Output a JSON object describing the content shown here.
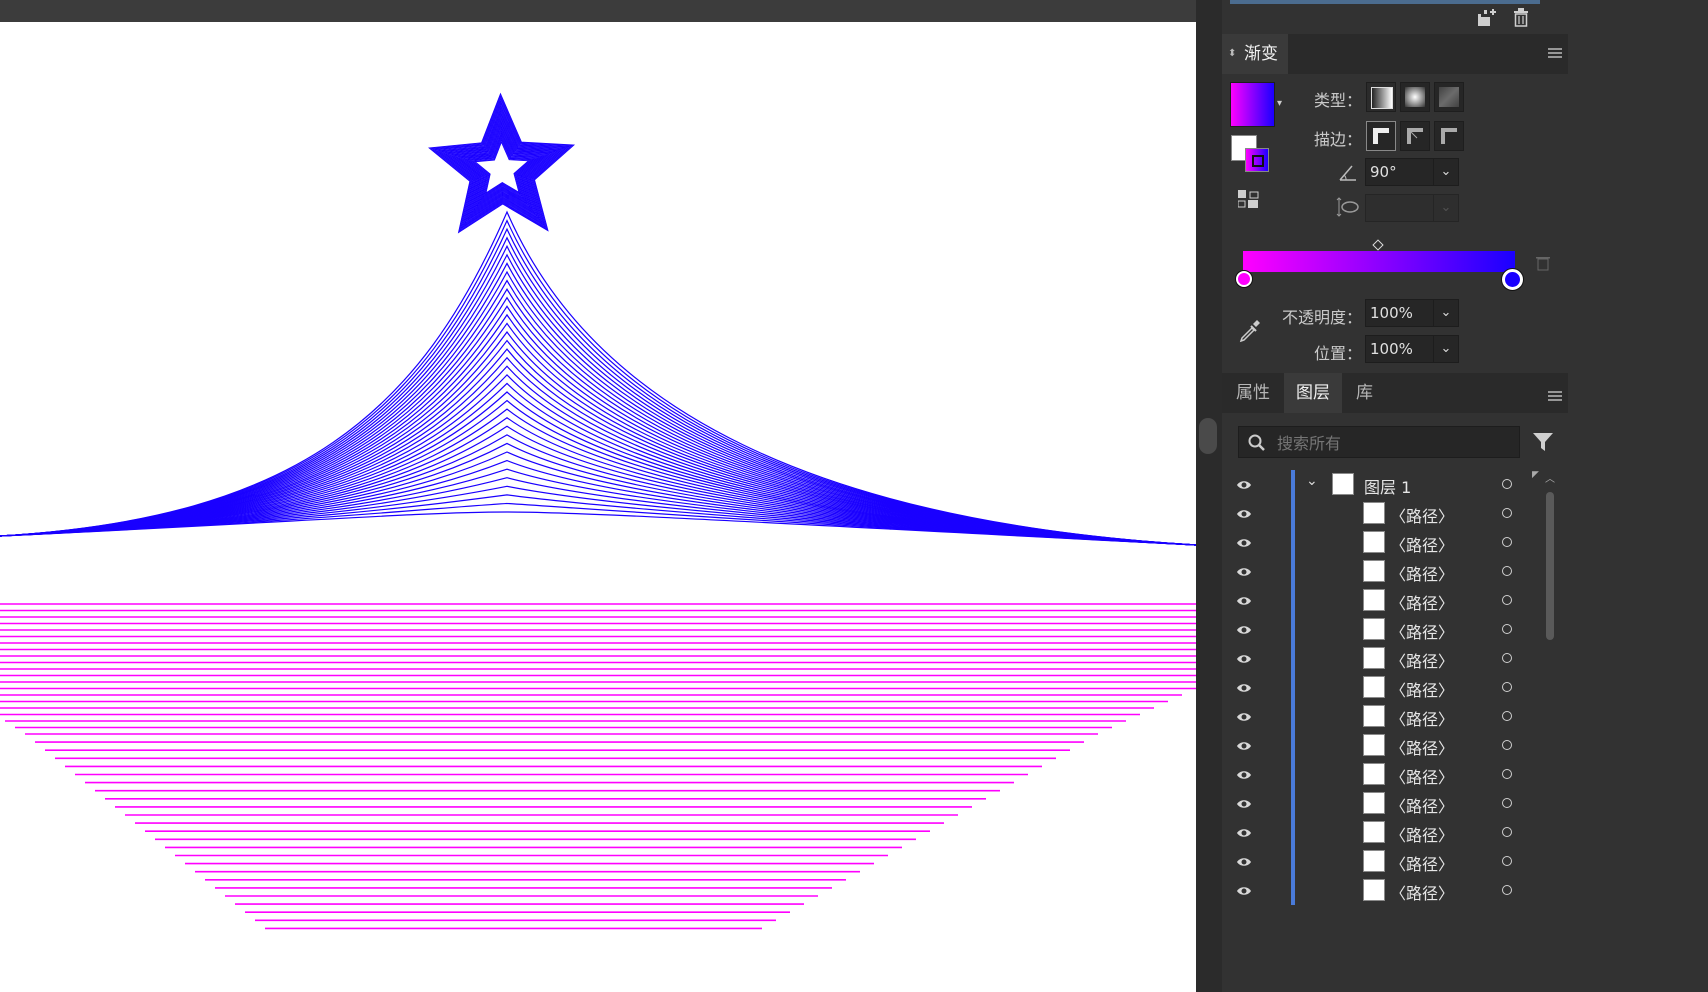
{
  "gradient_panel": {
    "title": "渐变",
    "type_label": "类型：",
    "stroke_label": "描边：",
    "angle_value": "90°",
    "opacity_label": "不透明度：",
    "opacity_value": "100%",
    "location_label": "位置：",
    "location_value": "100%",
    "start_color": "#ff00ff",
    "end_color": "#0000ff"
  },
  "layers_panel": {
    "tabs": [
      "属性",
      "图层",
      "库"
    ],
    "active_tab": "图层",
    "search_placeholder": "搜索所有",
    "layer_name": "图层 1",
    "items": [
      "〈路径〉",
      "〈路径〉",
      "〈路径〉",
      "〈路径〉",
      "〈路径〉",
      "〈路径〉",
      "〈路径〉",
      "〈路径〉",
      "〈路径〉",
      "〈路径〉",
      "〈路径〉",
      "〈路径〉",
      "〈路径〉",
      "〈路径〉"
    ]
  },
  "artwork": {
    "tree_color": "#1a00ff",
    "ground_color": "#ff00ff"
  }
}
